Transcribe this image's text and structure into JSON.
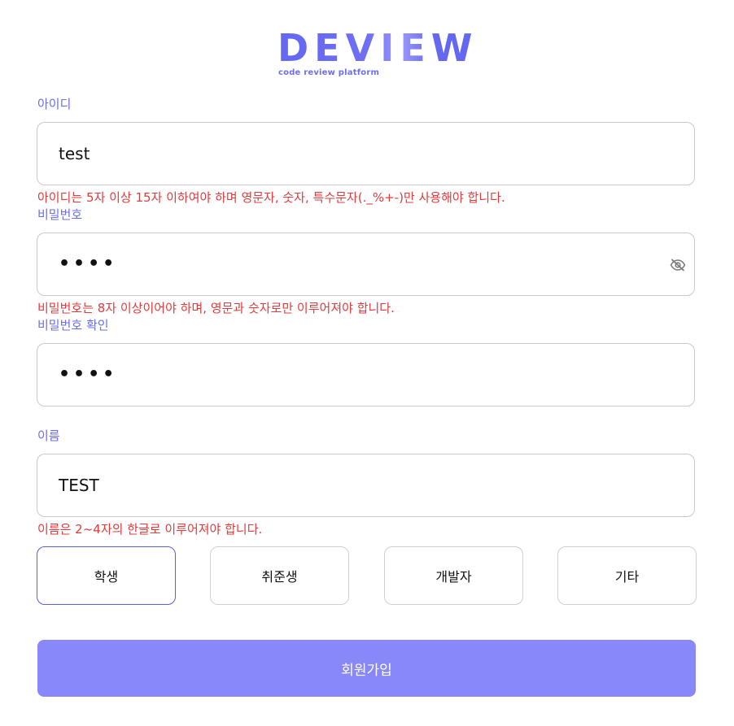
{
  "brand": {
    "name": "DEVIEW",
    "tagline": "code review platform",
    "accent_color": "#6467f0"
  },
  "form": {
    "id_field": {
      "label": "아이디",
      "value": "test",
      "error": "아이디는 5자 이상 15자 이하여야 하며 영문자, 숫자, 특수문자(._%+-)만 사용해야 합니다."
    },
    "password_field": {
      "label": "비밀번호",
      "value": "••••",
      "toggle_icon": "eye-slash-icon",
      "error": "비밀번호는 8자 이상이어야 하며, 영문과 숫자로만 이루어져야 합니다."
    },
    "password_confirm_field": {
      "label": "비밀번호 확인",
      "value": "••••"
    },
    "name_field": {
      "label": "이름",
      "value": "TEST",
      "error": "이름은 2~4자의 한글로 이루어져야 합니다."
    },
    "roles": [
      {
        "label": "학생",
        "selected": true
      },
      {
        "label": "취준생",
        "selected": false
      },
      {
        "label": "개발자",
        "selected": false
      },
      {
        "label": "기타",
        "selected": false
      }
    ],
    "submit_label": "회원가입",
    "colors": {
      "label": "#6b6ee6",
      "error": "#e23b3b",
      "submit_bg": "#8888fb",
      "selected_border": "#5b5fd9"
    }
  }
}
